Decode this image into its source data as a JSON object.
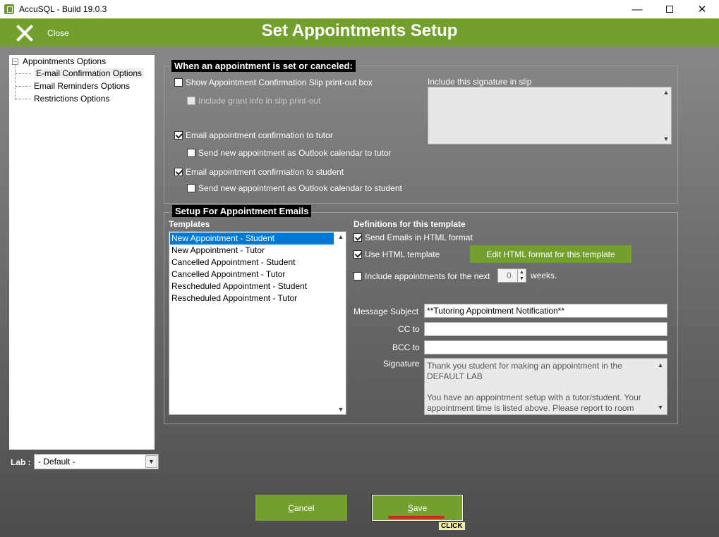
{
  "window": {
    "title": "AccuSQL - Build 19.0.3",
    "minimize": "—",
    "close": "✕"
  },
  "header": {
    "close_label": "Close",
    "title": "Set Appointments Setup"
  },
  "tree": {
    "root": "Appointments Options",
    "items": [
      "E-mail Confirmation Options",
      "Email Reminders Options",
      "Restrictions Options"
    ],
    "selected": "E-mail Confirmation Options"
  },
  "lab": {
    "label": "Lab :",
    "value": "- Default -"
  },
  "appointment_group": {
    "title": "When an appointment is set or canceled:",
    "show_slip": {
      "label": "Show Appointment Confirmation Slip print-out box",
      "checked": false
    },
    "include_grant": {
      "label": "Include grant info in slip print-out",
      "checked": false,
      "disabled": true
    },
    "email_tutor": {
      "label": "Email appointment confirmation to tutor",
      "checked": true
    },
    "outlook_tutor": {
      "label": "Send new appointment as Outlook calendar to tutor",
      "checked": false
    },
    "email_student": {
      "label": "Email appointment confirmation to student",
      "checked": true
    },
    "outlook_student": {
      "label": "Send new appointment as Outlook calendar to student",
      "checked": false
    },
    "signature_label": "Include this signature in slip"
  },
  "email_group": {
    "title": "Setup For Appointment Emails",
    "templates_label": "Templates",
    "templates": [
      "New Appointment - Student",
      "New Appointment - Tutor",
      "Cancelled Appointment - Student",
      "Cancelled Appointment - Tutor",
      "Rescheduled Appointment - Student",
      "Rescheduled Appointment - Tutor"
    ],
    "selected_template": "New Appointment - Student",
    "definitions_label": "Definitions for this template",
    "send_html": {
      "label": "Send Emails  in HTML format",
      "checked": true
    },
    "use_template": {
      "label": "Use HTML template",
      "checked": true
    },
    "edit_button": "Edit HTML format for this template",
    "include_next": {
      "label": "Include appointments for the next",
      "checked": false
    },
    "weeks_value": "0",
    "weeks_label": "weeks.",
    "subject_label": "Message Subject",
    "subject_value": "**Tutoring Appointment Notification**",
    "cc_label": "CC to",
    "cc_value": "",
    "bcc_label": "BCC to",
    "bcc_value": "",
    "signature_label": "Signature",
    "signature_line1": "Thank you student for making an appointment in the",
    "signature_line2": "DEFAULT LAB",
    "signature_line3": "You have an appointment setup with a tutor/student.  Your",
    "signature_line4": "appointment time is listed above.  Please report to room"
  },
  "buttons": {
    "cancel_first": "C",
    "cancel_rest": "ancel",
    "save_first": "S",
    "save_rest": "ave"
  },
  "overlay": {
    "click_tip": "CLICK"
  },
  "colors": {
    "accent": "#73a02d",
    "selection": "#0078d7"
  }
}
